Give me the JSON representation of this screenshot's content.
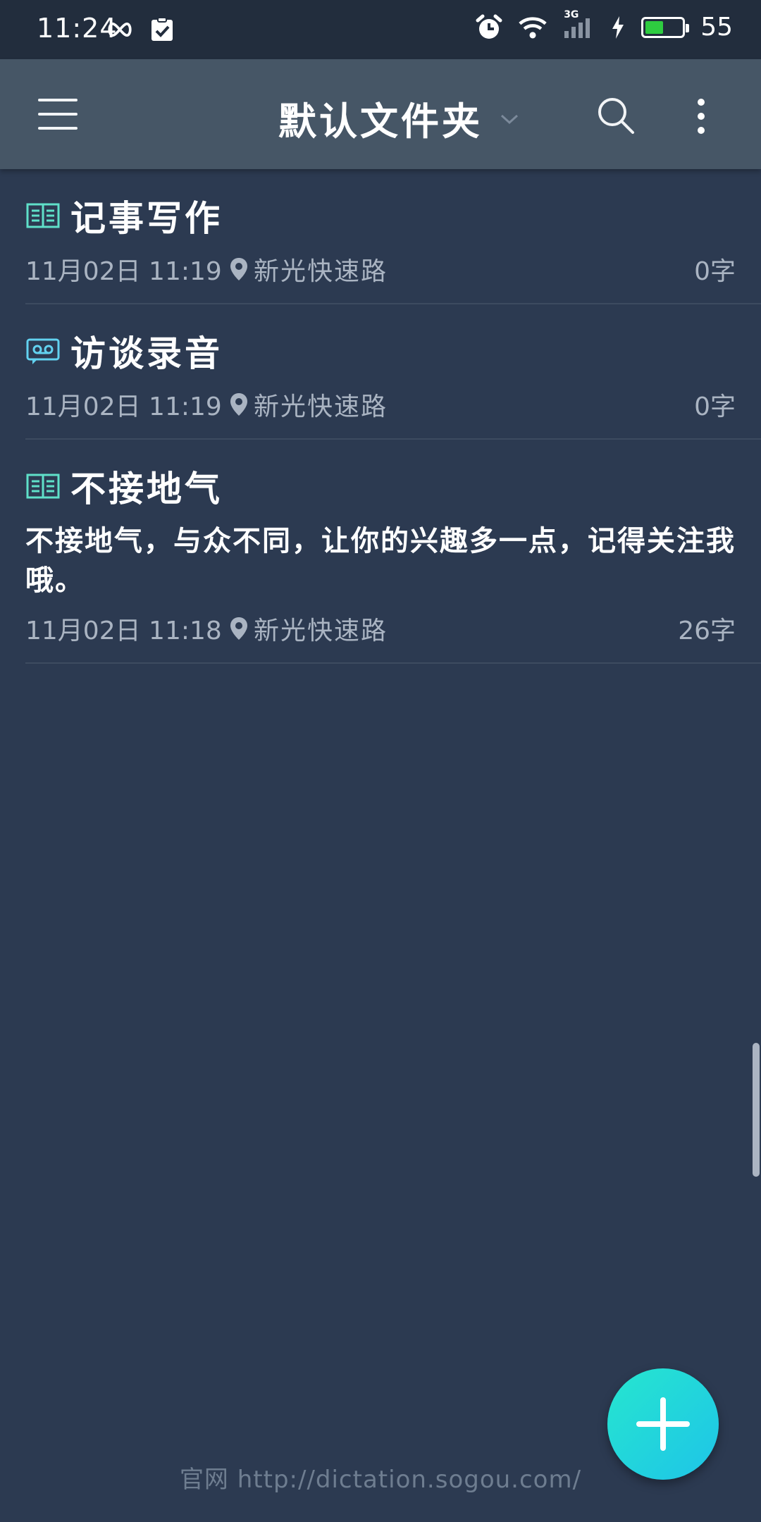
{
  "status_bar": {
    "time": "11:24",
    "network_label": "3G",
    "battery_percent": 55,
    "battery_text": "55"
  },
  "toolbar": {
    "title": "默认文件夹"
  },
  "notes": [
    {
      "icon": "book-icon",
      "title": "记事写作",
      "excerpt": "",
      "date": "11月02日 11:19",
      "location": "新光快速路",
      "count": "0字"
    },
    {
      "icon": "voicemail-icon",
      "title": "访谈录音",
      "excerpt": "",
      "date": "11月02日 11:19",
      "location": "新光快速路",
      "count": "0字"
    },
    {
      "icon": "book-icon",
      "title": "不接地气",
      "excerpt": "不接地气，与众不同，让你的兴趣多一点，记得关注我哦。",
      "date": "11月02日 11:18",
      "location": "新光快速路",
      "count": "26字"
    }
  ],
  "footer": {
    "url": "官网 http://dictation.sogou.com/"
  },
  "colors": {
    "background": "#2c3a51",
    "toolbar": "#465666",
    "status_bar": "#222d3d",
    "accent": "#26e6cf",
    "meta_text": "#aab4c2"
  }
}
